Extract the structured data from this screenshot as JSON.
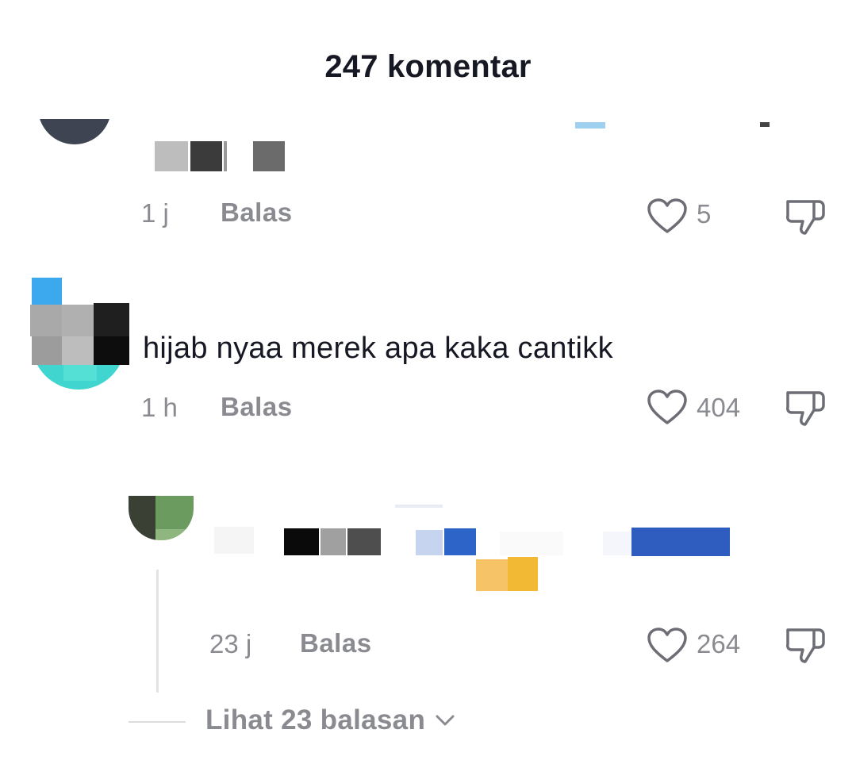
{
  "header": {
    "title": "247 komentar"
  },
  "comments": [
    {
      "time": "1 j",
      "reply_label": "Balas",
      "likes": "5"
    },
    {
      "text": "hijab nyaa merek apa kaka cantikk",
      "time": "1 h",
      "reply_label": "Balas",
      "likes": "404"
    },
    {
      "time": "23 j",
      "reply_label": "Balas",
      "likes": "264"
    }
  ],
  "view_replies": {
    "label": "Lihat 23 balasan"
  },
  "icons": {
    "like": "heart-outline-icon",
    "dislike": "thumbs-down-outline-icon",
    "expand": "chevron-down-icon"
  },
  "colors": {
    "text": "#161823",
    "muted": "#8a8b91",
    "icon": "#6d6e75"
  }
}
